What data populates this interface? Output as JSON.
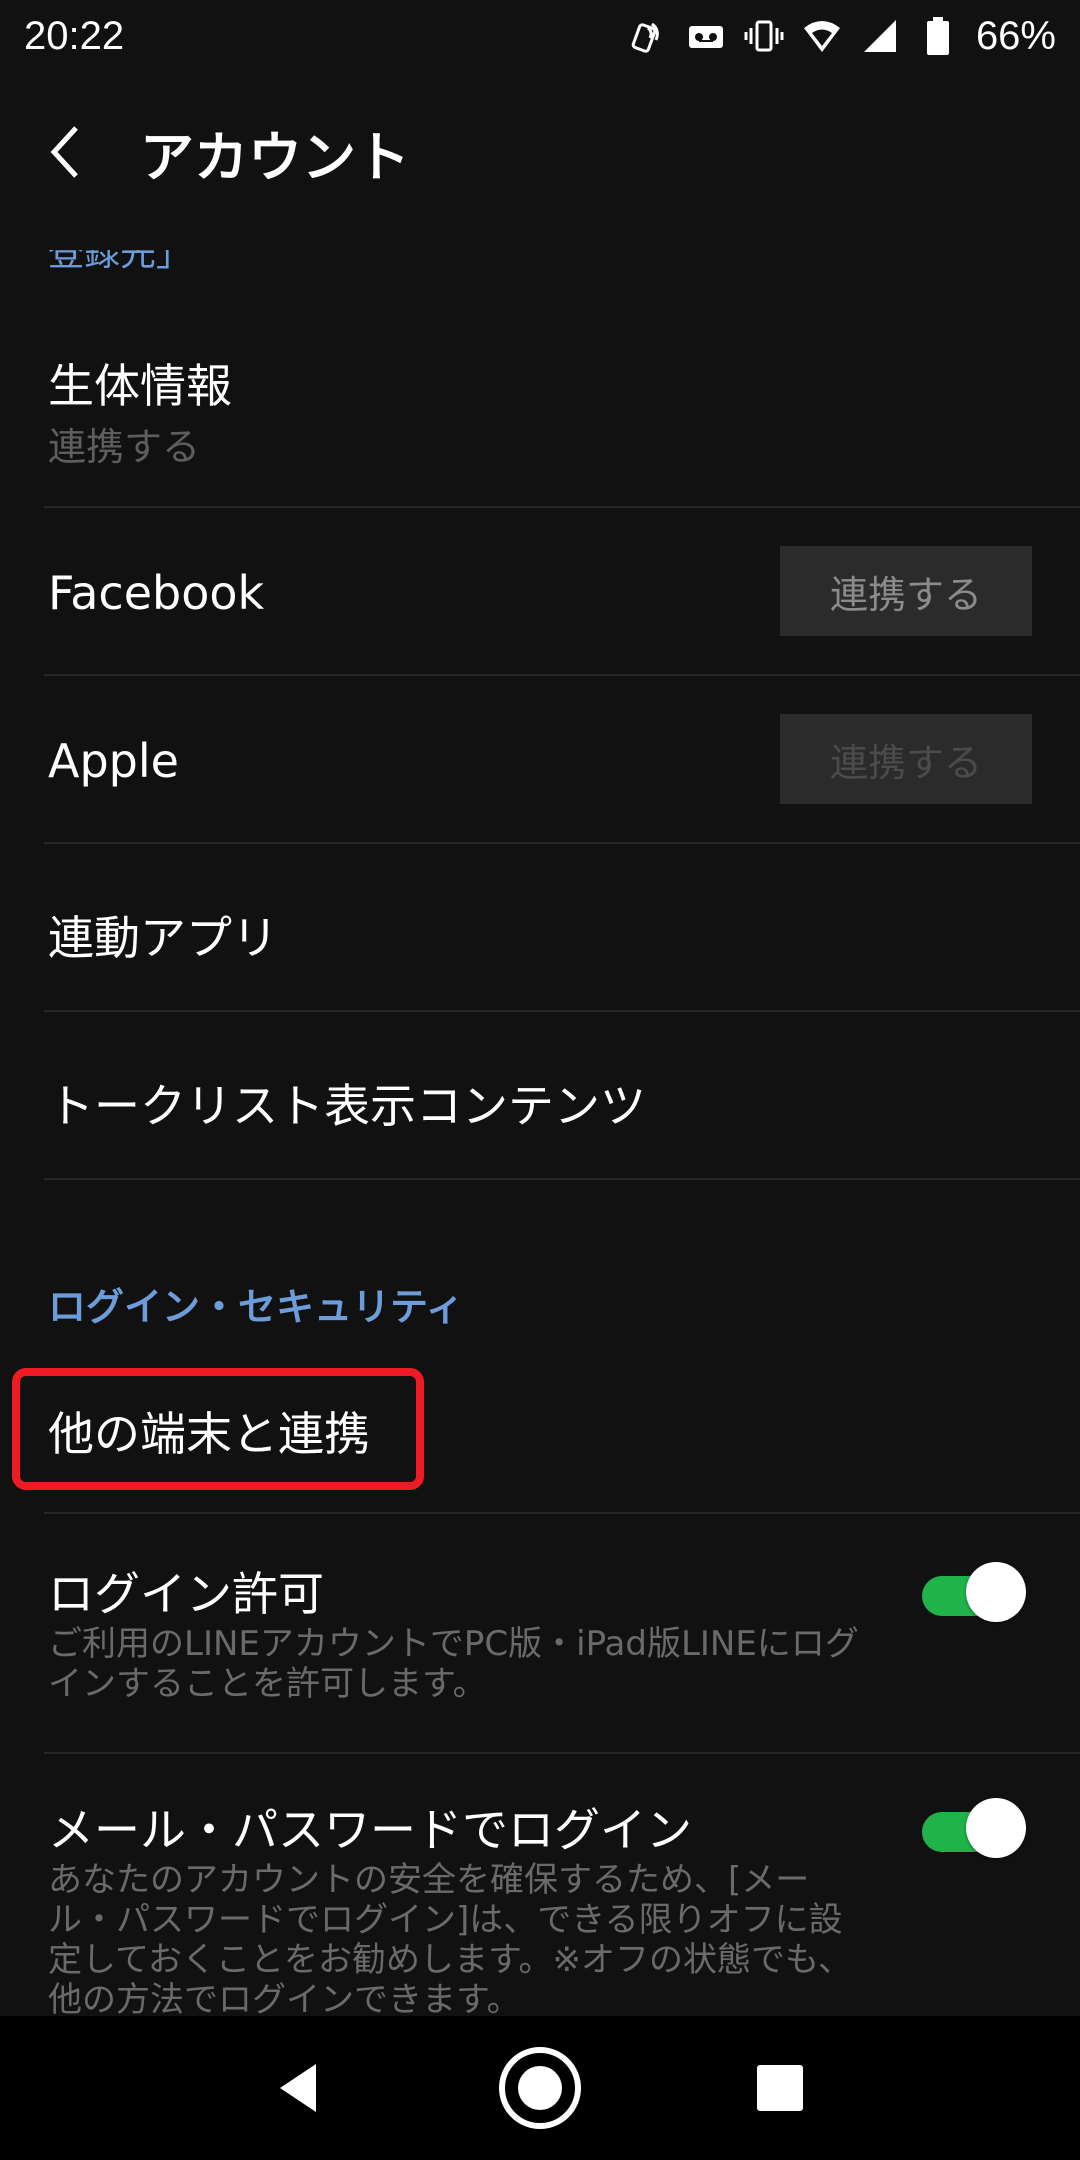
{
  "status_bar": {
    "time": "20:22",
    "battery": "66%",
    "icons": [
      "nfc-icon",
      "voicemail-icon",
      "vibrate-icon",
      "wifi-icon",
      "cell-signal-icon",
      "battery-icon"
    ]
  },
  "header": {
    "back_icon": "chevron-left-icon",
    "title": "アカウント"
  },
  "content": {
    "cut_link_text": "登録先」",
    "biometrics": {
      "title": "生体情報",
      "subtitle": "連携する"
    },
    "facebook": {
      "title": "Facebook",
      "button": "連携する"
    },
    "apple": {
      "title": "Apple",
      "button": "連携する"
    },
    "linked_apps": {
      "title": "連動アプリ"
    },
    "talklist": {
      "title": "トークリスト表示コンテンツ"
    },
    "section_login_security": "ログイン・セキュリティ",
    "other_devices": {
      "title": "他の端末と連携"
    },
    "login_permission": {
      "title": "ログイン許可",
      "description": "ご利用のLINEアカウントでPC版・iPad版LINEにログインすることを許可します。",
      "enabled": true
    },
    "email_login": {
      "title": "メール・パスワードでログイン",
      "description": "あなたのアカウントの安全を確保するため、[メール・パスワードでログイン]は、できる限りオフに設定しておくことをお勧めします。※オフの状態でも、他の方法でログインできます。",
      "enabled": true
    }
  },
  "colors": {
    "background": "#111111",
    "accent_blue": "#6c9cd9",
    "toggle_on": "#1fb34a",
    "highlight_red": "#ee1b24"
  },
  "nav_bar": {
    "back": "nav-back-icon",
    "home": "nav-home-icon",
    "recents": "nav-recents-icon"
  }
}
